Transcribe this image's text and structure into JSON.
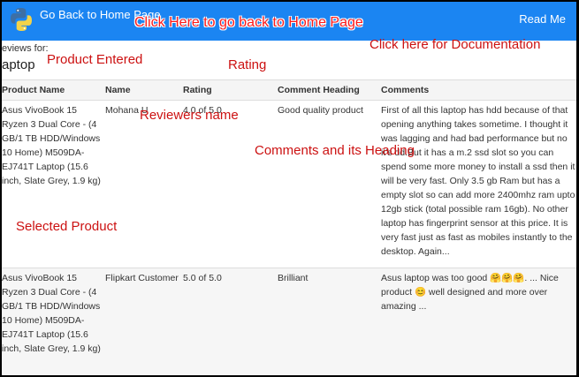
{
  "navbar": {
    "home_link": "Go Back to Home Page",
    "readme": "Read Me",
    "logo_icon": "python-logo-icon"
  },
  "search": {
    "reviews_for_label": "eviews for:",
    "query": "aptop"
  },
  "table": {
    "headers": [
      "Product Name",
      "Name",
      "Rating",
      "Comment Heading",
      "Comments"
    ],
    "rows": [
      {
        "product": "Asus VivoBook 15 Ryzen 3 Dual Core - (4 GB/1 TB HDD/Windows 10 Home) M509DA-EJ741T Laptop  (15.6 inch, Slate Grey, 1.9 kg)",
        "name": "Mohana U",
        "rating": "4.0 of 5.0",
        "heading": "Good quality product",
        "comment": "First of all this laptop has hdd because of that opening anything takes sometime. I thought it was lagging and had bad performance but no it's dd.But it has a m.2 ssd slot so you can spend some more money to install a ssd then it will be very fast. Only 3.5 gb Ram but has a empty slot so can add more 2400mhz ram upto 12gb stick (total possible ram 16gb). No other laptop has fingerprint sensor at this price. It is very fast just as fast as mobiles instantly to the desktop. Again..."
      },
      {
        "product": "Asus VivoBook 15 Ryzen 3 Dual Core - (4 GB/1 TB HDD/Windows 10 Home) M509DA-EJ741T Laptop  (15.6 inch, Slate Grey, 1.9 kg)",
        "name": "Flipkart Customer",
        "rating": "5.0 of 5.0",
        "heading": "Brilliant",
        "comment": "Asus laptop was too good 🤗🤗🤗. ... Nice product 😊 well designed and more over amazing ..."
      }
    ]
  },
  "annotations": {
    "home": "Click Here to go back to Home Page",
    "docs": "Click here for Documentation",
    "product_entered": "Product Entered",
    "rating": "Rating",
    "reviewers": "Reviewers name",
    "comments": "Comments and its Heading",
    "selected": "Selected Product"
  },
  "colors": {
    "navbar": "#1b85f2",
    "annotation": "#cc1111"
  }
}
